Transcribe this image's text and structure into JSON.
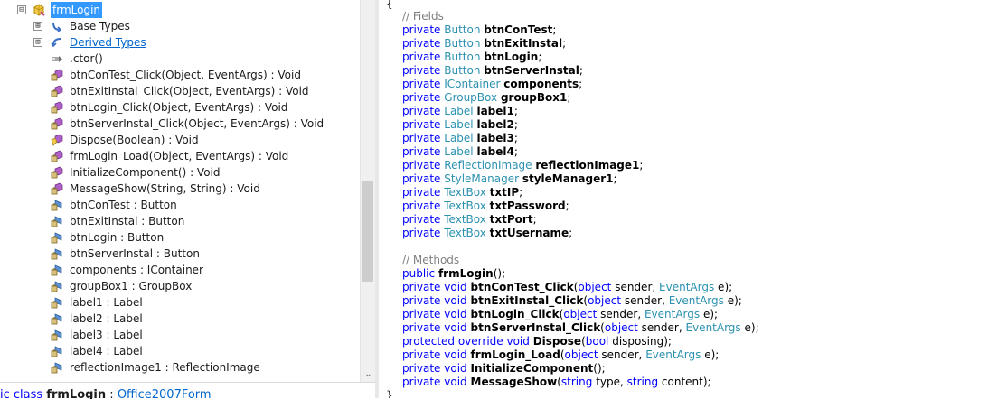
{
  "tree": {
    "root": {
      "label": "frmLogin",
      "expander": "⊟"
    },
    "items": [
      {
        "label": "Base Types",
        "expander": "⊞",
        "icon": "base-types-icon",
        "link": false
      },
      {
        "label": "Derived Types",
        "expander": "⊞",
        "icon": "derived-types-icon",
        "link": true
      },
      {
        "label": ".ctor()",
        "icon": "constructor-icon"
      },
      {
        "label": "btnConTest_Click(Object, EventArgs) : Void",
        "icon": "private-method-icon"
      },
      {
        "label": "btnExitInstal_Click(Object, EventArgs) : Void",
        "icon": "private-method-icon"
      },
      {
        "label": "btnLogin_Click(Object, EventArgs) : Void",
        "icon": "private-method-icon"
      },
      {
        "label": "btnServerInstal_Click(Object, EventArgs) : Void",
        "icon": "private-method-icon"
      },
      {
        "label": "Dispose(Boolean) : Void",
        "icon": "protected-method-icon"
      },
      {
        "label": "frmLogin_Load(Object, EventArgs) : Void",
        "icon": "private-method-icon"
      },
      {
        "label": "InitializeComponent() : Void",
        "icon": "private-method-icon"
      },
      {
        "label": "MessageShow(String, String) : Void",
        "icon": "private-method-icon"
      },
      {
        "label": "btnConTest : Button",
        "icon": "private-field-icon"
      },
      {
        "label": "btnExitInstal : Button",
        "icon": "private-field-icon"
      },
      {
        "label": "btnLogin : Button",
        "icon": "private-field-icon"
      },
      {
        "label": "btnServerInstal : Button",
        "icon": "private-field-icon"
      },
      {
        "label": "components : IContainer",
        "icon": "private-field-icon"
      },
      {
        "label": "groupBox1 : GroupBox",
        "icon": "private-field-icon"
      },
      {
        "label": "label1 : Label",
        "icon": "private-field-icon"
      },
      {
        "label": "label2 : Label",
        "icon": "private-field-icon"
      },
      {
        "label": "label3 : Label",
        "icon": "private-field-icon"
      },
      {
        "label": "label4 : Label",
        "icon": "private-field-icon"
      },
      {
        "label": "reflectionImage1 : ReflectionImage",
        "icon": "private-field-icon"
      }
    ]
  },
  "scrollbar": {
    "down_arrow": "⌄"
  },
  "status_line": {
    "prefix": "ic class ",
    "class_name": "frmLogin",
    "separator": " : ",
    "base_type": "Office2007Form"
  },
  "code": {
    "open_brace": "{",
    "close_brace": "}",
    "fields_comment": "// Fields",
    "fields": [
      {
        "mod": "private",
        "type": "Button",
        "name": "btnConTest"
      },
      {
        "mod": "private",
        "type": "Button",
        "name": "btnExitInstal"
      },
      {
        "mod": "private",
        "type": "Button",
        "name": "btnLogin"
      },
      {
        "mod": "private",
        "type": "Button",
        "name": "btnServerInstal"
      },
      {
        "mod": "private",
        "type": "IContainer",
        "name": "components"
      },
      {
        "mod": "private",
        "type": "GroupBox",
        "name": "groupBox1"
      },
      {
        "mod": "private",
        "type": "Label",
        "name": "label1"
      },
      {
        "mod": "private",
        "type": "Label",
        "name": "label2"
      },
      {
        "mod": "private",
        "type": "Label",
        "name": "label3"
      },
      {
        "mod": "private",
        "type": "Label",
        "name": "label4"
      },
      {
        "mod": "private",
        "type": "ReflectionImage",
        "name": "reflectionImage1"
      },
      {
        "mod": "private",
        "type": "StyleManager",
        "name": "styleManager1"
      },
      {
        "mod": "private",
        "type": "TextBox",
        "name": "txtIP"
      },
      {
        "mod": "private",
        "type": "TextBox",
        "name": "txtPassword"
      },
      {
        "mod": "private",
        "type": "TextBox",
        "name": "txtPort"
      },
      {
        "mod": "private",
        "type": "TextBox",
        "name": "txtUsername"
      }
    ],
    "methods_comment": "// Methods",
    "methods": [
      {
        "mod": "public",
        "ret": "",
        "name": "frmLogin",
        "params": []
      },
      {
        "mod": "private",
        "ret": "void",
        "name": "btnConTest_Click",
        "params": [
          {
            "t": "object",
            "n": "sender",
            "kw": true
          },
          {
            "t": "EventArgs",
            "n": "e",
            "kw": false
          }
        ]
      },
      {
        "mod": "private",
        "ret": "void",
        "name": "btnExitInstal_Click",
        "params": [
          {
            "t": "object",
            "n": "sender",
            "kw": true
          },
          {
            "t": "EventArgs",
            "n": "e",
            "kw": false
          }
        ]
      },
      {
        "mod": "private",
        "ret": "void",
        "name": "btnLogin_Click",
        "params": [
          {
            "t": "object",
            "n": "sender",
            "kw": true
          },
          {
            "t": "EventArgs",
            "n": "e",
            "kw": false
          }
        ]
      },
      {
        "mod": "private",
        "ret": "void",
        "name": "btnServerInstal_Click",
        "params": [
          {
            "t": "object",
            "n": "sender",
            "kw": true
          },
          {
            "t": "EventArgs",
            "n": "e",
            "kw": false
          }
        ]
      },
      {
        "mod": "protected override",
        "ret": "void",
        "name": "Dispose",
        "params": [
          {
            "t": "bool",
            "n": "disposing",
            "kw": true
          }
        ]
      },
      {
        "mod": "private",
        "ret": "void",
        "name": "frmLogin_Load",
        "params": [
          {
            "t": "object",
            "n": "sender",
            "kw": true
          },
          {
            "t": "EventArgs",
            "n": "e",
            "kw": false
          }
        ]
      },
      {
        "mod": "private",
        "ret": "void",
        "name": "InitializeComponent",
        "params": []
      },
      {
        "mod": "private",
        "ret": "void",
        "name": "MessageShow",
        "params": [
          {
            "t": "string",
            "n": "type",
            "kw": true
          },
          {
            "t": "string",
            "n": "content",
            "kw": true
          }
        ]
      }
    ]
  },
  "colors": {
    "keyword": "#0000ff",
    "type": "#2b91af",
    "comment": "#808080",
    "selection": "#3399ff",
    "link": "#0066cc"
  }
}
